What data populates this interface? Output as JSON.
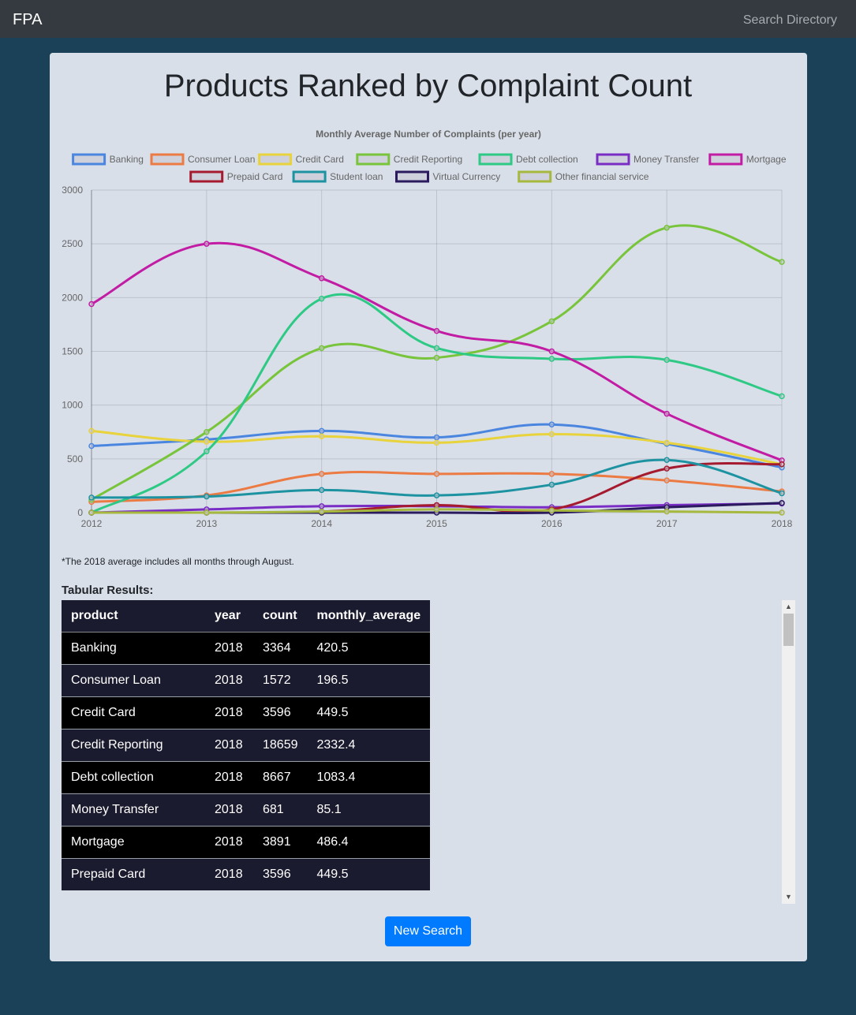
{
  "nav": {
    "brand": "FPA",
    "link": "Search Directory"
  },
  "page": {
    "title": "Products Ranked by Complaint Count",
    "footnote": "*The 2018 average includes all months through August.",
    "table_label": "Tabular Results:",
    "button_label": "New Search"
  },
  "chart_data": {
    "type": "line",
    "title": "Monthly Average Number of Complaints (per year)",
    "x": [
      "2012",
      "2013",
      "2014",
      "2015",
      "2016",
      "2017",
      "2018"
    ],
    "ylim": [
      0,
      3000
    ],
    "yticks": [
      0,
      500,
      1000,
      1500,
      2000,
      2500,
      3000
    ],
    "grid": true,
    "legend_position": "top",
    "series": [
      {
        "name": "Banking",
        "color": "#4a86e0",
        "values": [
          620,
          680,
          760,
          700,
          820,
          640,
          420
        ]
      },
      {
        "name": "Consumer Loan",
        "color": "#ec7a43",
        "values": [
          100,
          160,
          360,
          360,
          360,
          300,
          197
        ]
      },
      {
        "name": "Credit Card",
        "color": "#e8d33c",
        "values": [
          760,
          660,
          710,
          650,
          730,
          650,
          450
        ]
      },
      {
        "name": "Credit Reporting",
        "color": "#78c43a",
        "values": [
          120,
          750,
          1530,
          1440,
          1780,
          2650,
          2332
        ]
      },
      {
        "name": "Debt collection",
        "color": "#2ec984",
        "values": [
          0,
          570,
          1990,
          1530,
          1430,
          1420,
          1083
        ]
      },
      {
        "name": "Money Transfer",
        "color": "#7a2dc4",
        "values": [
          0,
          30,
          60,
          60,
          50,
          70,
          85
        ]
      },
      {
        "name": "Mortgage",
        "color": "#c21ba4",
        "values": [
          1940,
          2500,
          2180,
          1690,
          1500,
          920,
          486
        ]
      },
      {
        "name": "Prepaid Card",
        "color": "#a51a2e",
        "values": [
          0,
          0,
          10,
          70,
          30,
          410,
          450
        ]
      },
      {
        "name": "Student loan",
        "color": "#1d93a1",
        "values": [
          140,
          150,
          210,
          160,
          260,
          490,
          180
        ]
      },
      {
        "name": "Virtual Currency",
        "color": "#2b1b5e",
        "values": [
          0,
          0,
          0,
          0,
          0,
          50,
          90
        ]
      },
      {
        "name": "Other financial service",
        "color": "#a6b83e",
        "values": [
          0,
          0,
          10,
          30,
          20,
          10,
          0
        ]
      }
    ]
  },
  "table": {
    "columns": [
      "product",
      "year",
      "count",
      "monthly_average"
    ],
    "rows": [
      [
        "Banking",
        "2018",
        "3364",
        "420.5"
      ],
      [
        "Consumer Loan",
        "2018",
        "1572",
        "196.5"
      ],
      [
        "Credit Card",
        "2018",
        "3596",
        "449.5"
      ],
      [
        "Credit Reporting",
        "2018",
        "18659",
        "2332.4"
      ],
      [
        "Debt collection",
        "2018",
        "8667",
        "1083.4"
      ],
      [
        "Money Transfer",
        "2018",
        "681",
        "85.1"
      ],
      [
        "Mortgage",
        "2018",
        "3891",
        "486.4"
      ],
      [
        "Prepaid Card",
        "2018",
        "3596",
        "449.5"
      ]
    ]
  },
  "icons": {
    "scroll_up": "up-arrow-icon",
    "scroll_down": "down-arrow-icon"
  }
}
